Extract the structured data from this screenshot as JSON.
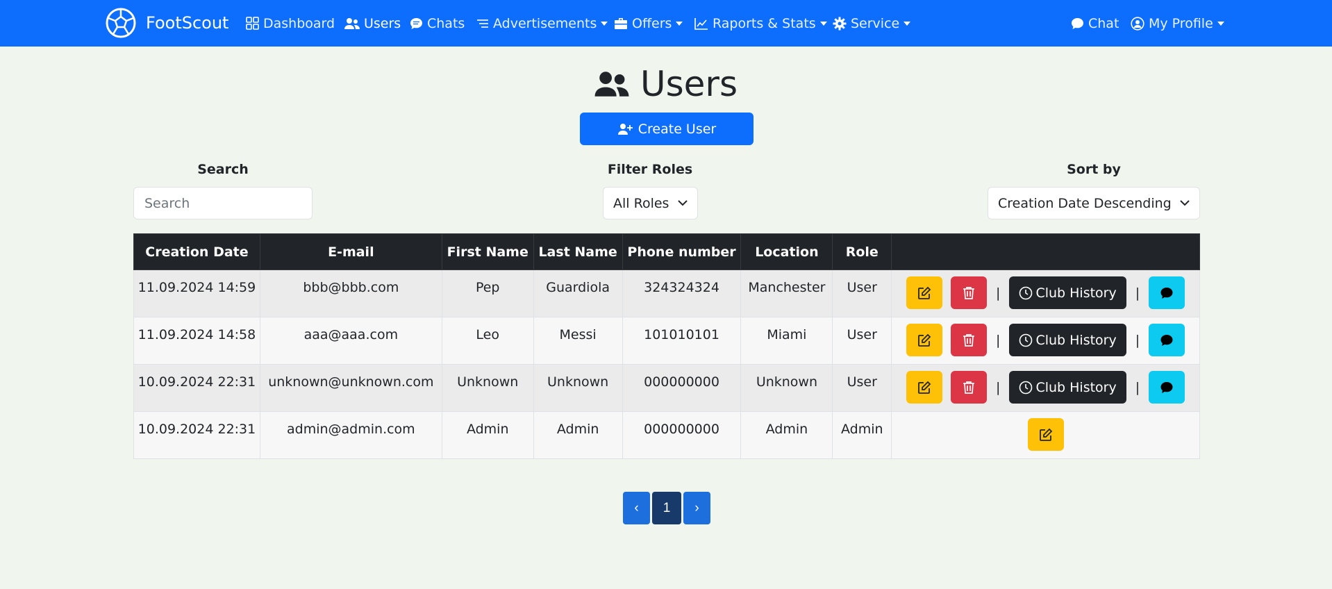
{
  "brand": {
    "name": "FootScout"
  },
  "nav": {
    "dashboard": "Dashboard",
    "users": "Users",
    "chats": "Chats",
    "advertisements": "Advertisements",
    "offers": "Offers",
    "stats": "Raports & Stats",
    "service": "Service",
    "chat": "Chat",
    "profile": "My Profile"
  },
  "page": {
    "title": "Users",
    "create_label": "Create User"
  },
  "filters": {
    "search_label": "Search",
    "search_placeholder": "Search",
    "roles_label": "Filter Roles",
    "roles_value": "All Roles",
    "sort_label": "Sort by",
    "sort_value": "Creation Date Descending"
  },
  "table": {
    "headers": [
      "Creation Date",
      "E-mail",
      "First Name",
      "Last Name",
      "Phone number",
      "Location",
      "Role"
    ],
    "club_history_label": "Club History",
    "separator": "|",
    "rows": [
      [
        "11.09.2024 14:59",
        "bbb@bbb.com",
        "Pep",
        "Guardiola",
        "324324324",
        "Manchester",
        "User"
      ],
      [
        "11.09.2024 14:58",
        "aaa@aaa.com",
        "Leo",
        "Messi",
        "101010101",
        "Miami",
        "User"
      ],
      [
        "10.09.2024 22:31",
        "unknown@unknown.com",
        "Unknown",
        "Unknown",
        "000000000",
        "Unknown",
        "User"
      ],
      [
        "10.09.2024 22:31",
        "admin@admin.com",
        "Admin",
        "Admin",
        "000000000",
        "Admin",
        "Admin"
      ]
    ]
  },
  "pagination": {
    "prev": "‹",
    "current": "1",
    "next": "›"
  },
  "colors": {
    "primary": "#0d6efd",
    "warning": "#ffc107",
    "danger": "#dc3545",
    "dark": "#212529",
    "info": "#0dcaf0"
  }
}
